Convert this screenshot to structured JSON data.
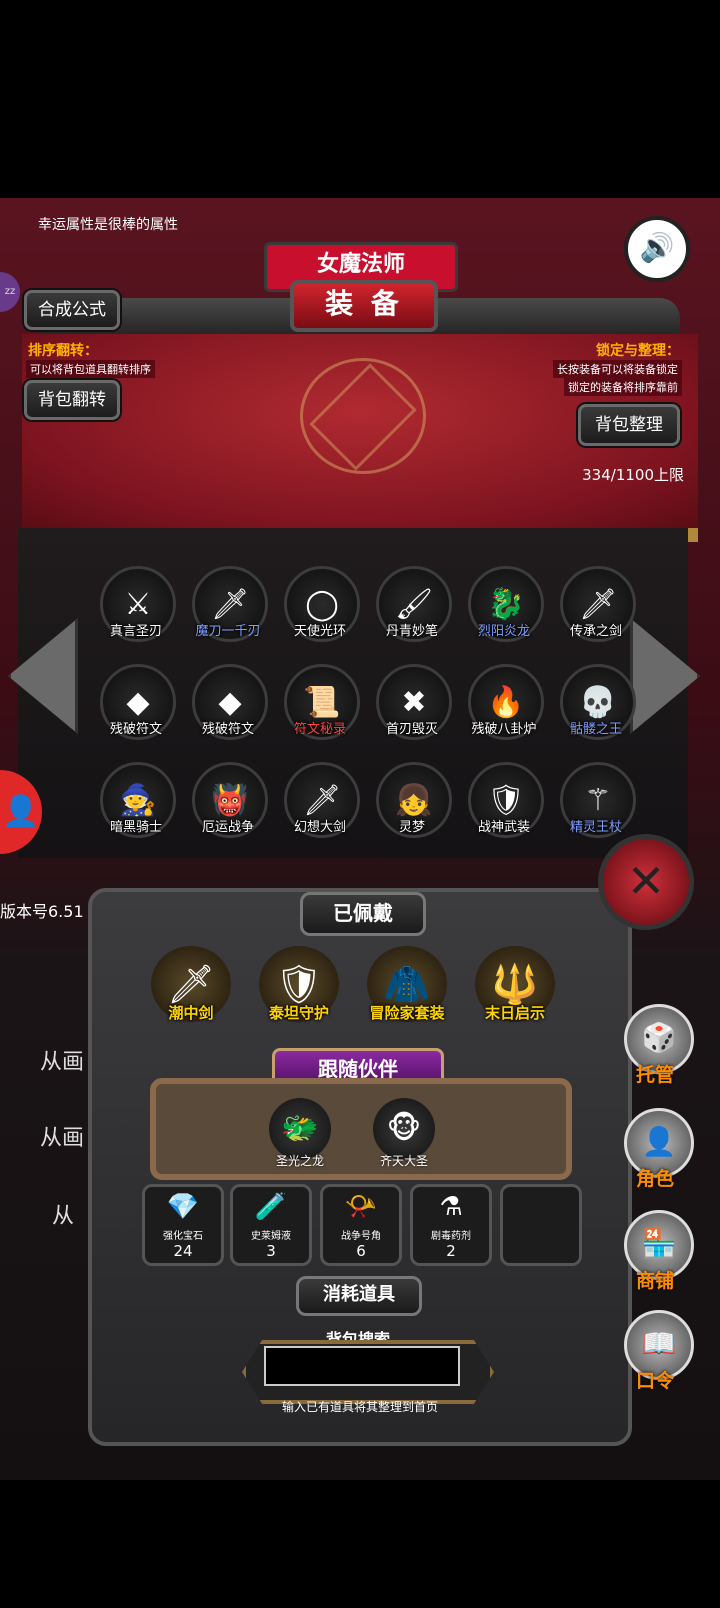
{
  "top_tip": "幸运属性是很棒的属性",
  "character_name": "女魔法师",
  "panel_title": "装 备",
  "left_panel": {
    "synth_button": "合成公式",
    "sort_title": "排序翻转：",
    "sort_desc": "可以将背包道具翻转排序",
    "flip_button": "背包翻转"
  },
  "right_panel": {
    "lock_title": "锁定与整理：",
    "lock_desc1": "长按装备可以将装备锁定",
    "lock_desc2": "锁定的装备将排序靠前",
    "arrange_button": "背包整理"
  },
  "bag_count": "334/1100上限",
  "zzz_badge": "zz",
  "items": [
    {
      "label": "真言圣刃",
      "icon": "sword-axe-icon",
      "glyph": "⚔",
      "color": "white"
    },
    {
      "label": "魔刀一千刃",
      "icon": "katana-icon",
      "glyph": "🗡",
      "color": "blue"
    },
    {
      "label": "天使光环",
      "icon": "halo-icon",
      "glyph": "◯",
      "color": "white"
    },
    {
      "label": "丹青妙笔",
      "icon": "brush-icon",
      "glyph": "🖌",
      "color": "white"
    },
    {
      "label": "烈阳炎龙",
      "icon": "fire-dragon-icon",
      "glyph": "🐉",
      "color": "blue"
    },
    {
      "label": "传承之剑",
      "icon": "sword-icon",
      "glyph": "🗡",
      "color": "white"
    },
    {
      "label": "残破符文",
      "icon": "rune-stone-icon",
      "glyph": "◆",
      "color": "white"
    },
    {
      "label": "残破符文",
      "icon": "rune-stone-icon",
      "glyph": "◆",
      "color": "white"
    },
    {
      "label": "符文秘录",
      "icon": "scroll-icon",
      "glyph": "📜",
      "color": "red"
    },
    {
      "label": "首刃毁灭",
      "icon": "crossed-blades-icon",
      "glyph": "✖",
      "color": "white"
    },
    {
      "label": "残破八卦炉",
      "icon": "furnace-icon",
      "glyph": "🔥",
      "color": "white"
    },
    {
      "label": "骷髅之王",
      "icon": "skull-king-icon",
      "glyph": "💀",
      "color": "blue"
    },
    {
      "label": "暗黑骑士",
      "icon": "dark-knight-icon",
      "glyph": "🧙",
      "color": "white"
    },
    {
      "label": "厄运战争",
      "icon": "war-demon-icon",
      "glyph": "👹",
      "color": "white"
    },
    {
      "label": "幻想大剑",
      "icon": "greatsword-icon",
      "glyph": "🗡",
      "color": "white"
    },
    {
      "label": "灵梦",
      "icon": "shrine-maiden-icon",
      "glyph": "👧",
      "color": "white"
    },
    {
      "label": "战神武装",
      "icon": "war-god-armor-icon",
      "glyph": "🛡",
      "color": "white"
    },
    {
      "label": "精灵王杖",
      "icon": "scepter-icon",
      "glyph": "⚚",
      "color": "blue"
    }
  ],
  "equipped": {
    "title": "已佩戴",
    "items": [
      {
        "label": "潮中剑",
        "icon": "flame-sword-icon",
        "glyph": "🗡"
      },
      {
        "label": "泰坦守护",
        "icon": "titan-armor-icon",
        "glyph": "🛡"
      },
      {
        "label": "冒险家套装",
        "icon": "adventurer-outfit-icon",
        "glyph": "🧥"
      },
      {
        "label": "末日启示",
        "icon": "trident-icon",
        "glyph": "🔱"
      }
    ]
  },
  "followers": {
    "title": "跟随伙伴",
    "items": [
      {
        "label": "圣光之龙",
        "icon": "gold-dragon-icon",
        "glyph": "🐲"
      },
      {
        "label": "齐天大圣",
        "icon": "monkey-king-icon",
        "glyph": "🐵"
      }
    ]
  },
  "consumables": {
    "title": "消耗道具",
    "items": [
      {
        "label": "强化宝石",
        "count": "24",
        "icon": "green-gem-icon",
        "glyph": "💎"
      },
      {
        "label": "史莱姆液",
        "count": "3",
        "icon": "potion-bottle-icon",
        "glyph": "🧪"
      },
      {
        "label": "战争号角",
        "count": "6",
        "icon": "war-horn-icon",
        "glyph": "📯"
      },
      {
        "label": "剧毒药剂",
        "count": "2",
        "icon": "poison-flask-icon",
        "glyph": "⚗"
      }
    ]
  },
  "search": {
    "title": "背包搜索",
    "value": "",
    "hint": "输入已有道具将其整理到首页"
  },
  "side_menu": [
    {
      "label": "托管",
      "icon": "dice-icon",
      "glyph": "🎲"
    },
    {
      "label": "角色",
      "icon": "hooded-figure-icon",
      "glyph": "👤"
    },
    {
      "label": "商铺",
      "icon": "shop-icon",
      "glyph": "🏪"
    },
    {
      "label": "口令",
      "icon": "book-icon",
      "glyph": "📖"
    }
  ],
  "version": "版本号6.51",
  "background_texts": [
    "从画",
    "从画 甲",
    "从"
  ],
  "colors": {
    "accent_gold": "#ffd400",
    "title_red": "#c8102e",
    "note_orange": "#ffb000",
    "side_label_orange": "#ff8c00",
    "blue_rarity": "#7f9cff",
    "red_rarity": "#ff4040"
  }
}
